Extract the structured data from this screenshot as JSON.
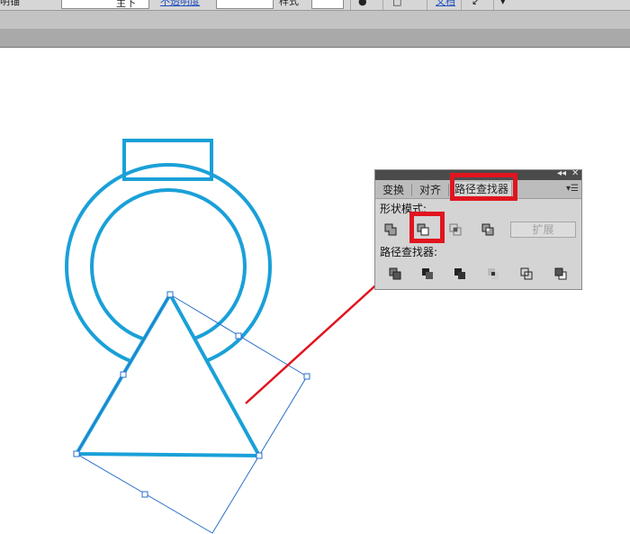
{
  "control_bar": {
    "left_fragment": "明锚",
    "field1_value": "主下",
    "link_label": "不透明度",
    "field2_value": "",
    "style_label": "样式",
    "right_link": "文档"
  },
  "pathfinder_panel": {
    "tabs": [
      {
        "label": "变换"
      },
      {
        "label": "对齐"
      },
      {
        "label": "路径查找器"
      }
    ],
    "shape_modes_label": "形状模式:",
    "shape_modes": [
      {
        "icon": "unite-icon"
      },
      {
        "icon": "minus-front-icon"
      },
      {
        "icon": "intersect-icon"
      },
      {
        "icon": "exclude-icon"
      }
    ],
    "expand_label": "扩展",
    "pathfinders_label": "路径查找器:",
    "pathfinders": [
      {
        "icon": "divide-icon"
      },
      {
        "icon": "trim-icon"
      },
      {
        "icon": "merge-icon"
      },
      {
        "icon": "crop-icon"
      },
      {
        "icon": "outline-icon"
      },
      {
        "icon": "minus-back-icon"
      }
    ]
  },
  "colors": {
    "stroke": "#1aa0d8",
    "highlight": "#e0151f",
    "selection": "#2a6fc9"
  }
}
